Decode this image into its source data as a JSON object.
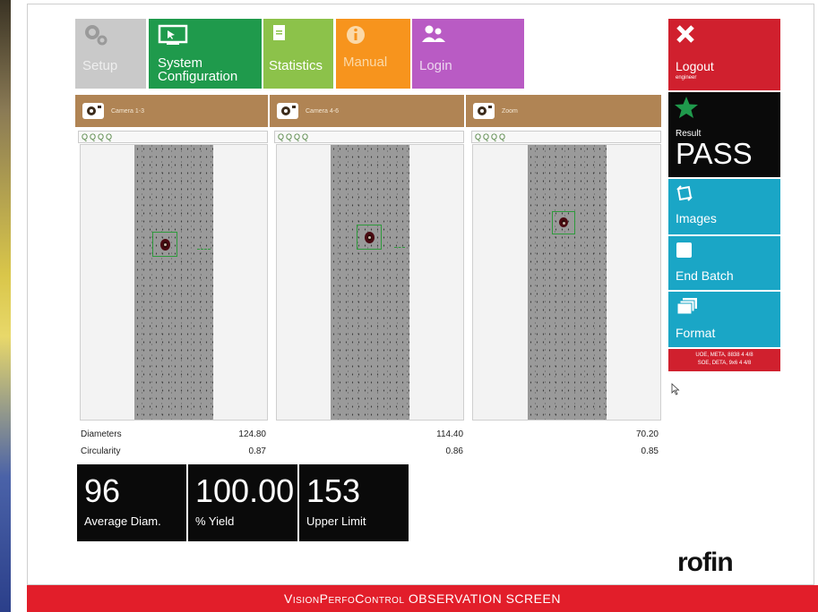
{
  "top_tiles": [
    {
      "label": "Setup",
      "icon": "gears-icon",
      "color": "#c9c9c9"
    },
    {
      "label": "System\nConfiguration",
      "icon": "monitor-cursor-icon",
      "color": "#1f9a4c"
    },
    {
      "label": "Statistics",
      "icon": "document-icon",
      "color": "#8cc24a"
    },
    {
      "label": "Manual",
      "icon": "info-icon",
      "color": "#f7941d"
    },
    {
      "label": "Login",
      "icon": "users-icon",
      "color": "#b95bc4"
    }
  ],
  "cameras": [
    {
      "label": "Camera 1-3",
      "diameter": "124.80",
      "circularity": "0.87"
    },
    {
      "label": "Camera 4-6",
      "diameter": "114.40",
      "circularity": "0.86"
    },
    {
      "label": "Zoom",
      "diameter": "70.20",
      "circularity": "0.85"
    }
  ],
  "zoom_tools": "QQQQ",
  "measurements": {
    "diameters_label": "Diameters",
    "circularity_label": "Circularity"
  },
  "kpis": [
    {
      "value": "96",
      "caption": "Average Diam."
    },
    {
      "value": "100.00",
      "caption": "% Yield"
    },
    {
      "value": "153",
      "caption": "Upper Limit"
    }
  ],
  "sidebar": {
    "logout": {
      "label": "Logout",
      "user": "engineer"
    },
    "result": {
      "title": "Result",
      "value": "PASS"
    },
    "images": {
      "label": "Images"
    },
    "end_batch": {
      "label": "End Batch"
    },
    "format": {
      "label": "Format"
    },
    "status_lines": [
      "UOE, META, 8838 4 4/8",
      "SOE, DETA, 9x6 4 4/8"
    ]
  },
  "brand": "rofin",
  "footer": {
    "part1": "VisionPerfoControl",
    "part2": "OBSERVATION SCREEN"
  },
  "colors": {
    "header_brown": "#b08454",
    "logout_red": "#d0202e",
    "result_black": "#0a0a0a",
    "teal": "#1aa6c6",
    "footer_red": "#e21e2a",
    "roi_green": "#2e9a3c"
  }
}
